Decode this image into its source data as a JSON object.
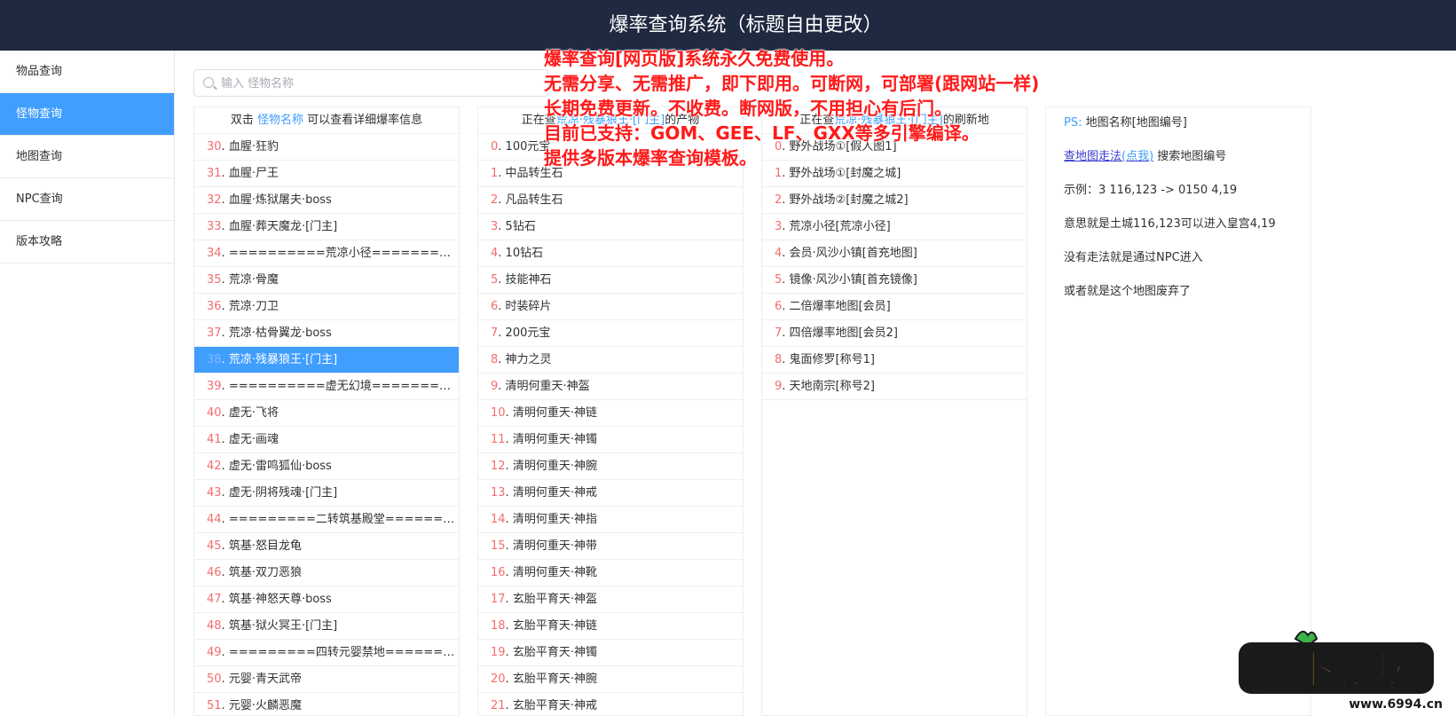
{
  "app": {
    "title": "爆率查询系统（标题自由更改）"
  },
  "sidebar": {
    "items": [
      {
        "label": "物品查询",
        "active": false
      },
      {
        "label": "怪物查询",
        "active": true
      },
      {
        "label": "地图查询",
        "active": false
      },
      {
        "label": "NPC查询",
        "active": false
      },
      {
        "label": "版本攻略",
        "active": false
      }
    ]
  },
  "search": {
    "placeholder": "输入 怪物名称",
    "value": ""
  },
  "monsters": {
    "header": {
      "prefix": "双击 ",
      "highlight": "怪物名称",
      "suffix": " 可以查看详细爆率信息"
    },
    "rows": [
      {
        "num": "30",
        "name": "血腥·狂豹"
      },
      {
        "num": "31",
        "name": "血腥·尸王"
      },
      {
        "num": "32",
        "name": "血腥·炼狱屠夫·boss"
      },
      {
        "num": "33",
        "name": "血腥·葬天魔龙·[门主]"
      },
      {
        "num": "34",
        "name": "==========荒凉小径=========="
      },
      {
        "num": "35",
        "name": "荒凉·骨魔"
      },
      {
        "num": "36",
        "name": "荒凉·刀卫"
      },
      {
        "num": "37",
        "name": "荒凉·枯骨翼龙·boss"
      },
      {
        "num": "38",
        "name": "荒凉·残暴狼王·[门主]",
        "selected": true
      },
      {
        "num": "39",
        "name": "==========虚无幻境=========="
      },
      {
        "num": "40",
        "name": "虚无·飞将"
      },
      {
        "num": "41",
        "name": "虚无·画魂"
      },
      {
        "num": "42",
        "name": "虚无·雷鸣狐仙·boss"
      },
      {
        "num": "43",
        "name": "虚无·阴将残魂·[门主]"
      },
      {
        "num": "44",
        "name": "=========二转筑基殿堂=========="
      },
      {
        "num": "45",
        "name": "筑基·怒目龙龟"
      },
      {
        "num": "46",
        "name": "筑基·双刀恶狼"
      },
      {
        "num": "47",
        "name": "筑基·神怒天尊·boss"
      },
      {
        "num": "48",
        "name": "筑基·狱火冥王·[门主]"
      },
      {
        "num": "49",
        "name": "=========四转元婴禁地=========="
      },
      {
        "num": "50",
        "name": "元婴·青天武帝"
      },
      {
        "num": "51",
        "name": "元婴·火麟恶魔"
      }
    ]
  },
  "drops": {
    "header": {
      "prefix": "正在查",
      "highlight": "荒凉·残暴狼王·[门主]",
      "suffix": "的产物"
    },
    "rows": [
      {
        "num": "0",
        "name": "100元宝"
      },
      {
        "num": "1",
        "name": "中品转生石"
      },
      {
        "num": "2",
        "name": "凡品转生石"
      },
      {
        "num": "3",
        "name": "5钻石"
      },
      {
        "num": "4",
        "name": "10钻石"
      },
      {
        "num": "5",
        "name": "技能神石"
      },
      {
        "num": "6",
        "name": "时装碎片"
      },
      {
        "num": "7",
        "name": "200元宝"
      },
      {
        "num": "8",
        "name": "神力之灵"
      },
      {
        "num": "9",
        "name": "清明何重天·神盔"
      },
      {
        "num": "10",
        "name": "清明何重天·神链"
      },
      {
        "num": "11",
        "name": "清明何重天·神镯"
      },
      {
        "num": "12",
        "name": "清明何重天·神腕"
      },
      {
        "num": "13",
        "name": "清明何重天·神戒"
      },
      {
        "num": "14",
        "name": "清明何重天·神指"
      },
      {
        "num": "15",
        "name": "清明何重天·神带"
      },
      {
        "num": "16",
        "name": "清明何重天·神靴"
      },
      {
        "num": "17",
        "name": "玄胎平育天·神盔"
      },
      {
        "num": "18",
        "name": "玄胎平育天·神链"
      },
      {
        "num": "19",
        "name": "玄胎平育天·神镯"
      },
      {
        "num": "20",
        "name": "玄胎平育天·神腕"
      },
      {
        "num": "21",
        "name": "玄胎平育天·神戒"
      }
    ]
  },
  "maps": {
    "header": {
      "prefix": "正在查",
      "highlight": "荒凉·残暴狼王·[门主]",
      "suffix": "的刷新地"
    },
    "rows": [
      {
        "num": "0",
        "name": "野外战场①[假人图1]"
      },
      {
        "num": "1",
        "name": "野外战场①[封魔之城]"
      },
      {
        "num": "2",
        "name": "野外战场②[封魔之城2]"
      },
      {
        "num": "3",
        "name": "荒凉小径[荒凉小径]"
      },
      {
        "num": "4",
        "name": "会员·风沙小镇[首充地图]"
      },
      {
        "num": "5",
        "name": "镜像·风沙小镇[首充镜像]"
      },
      {
        "num": "6",
        "name": "二倍爆率地图[会员]"
      },
      {
        "num": "7",
        "name": "四倍爆率地图[会员2]"
      },
      {
        "num": "8",
        "name": "鬼面修罗[称号1]"
      },
      {
        "num": "9",
        "name": "天地南宗[称号2]"
      }
    ]
  },
  "info": {
    "ps_label": "PS:",
    "ps_text": " 地图名称[地图编号]",
    "link_text": "查地图走法",
    "link_hint": "(点我)",
    "link_suffix": " 搜索地图编号",
    "example": "示例：3 116,123 -> 0150 4,19",
    "meaning": "意思就是土城116,123可以进入皇宫4,19",
    "no_path": "没有走法就是通过NPC进入",
    "abandoned": "或者就是这个地图废弃了"
  },
  "overlay": {
    "lines": [
      "爆率查询[网页版]系统永久免费使用。",
      "无需分享、无需推广，即下即用。可断网，可部署(跟网站一样)",
      "长期免费更新。不收费。断网版，不用担心有后门。",
      "目前已支持：GOM、GEE、LF、GXX等多引擎编译。",
      "提供多版本爆率查询模板。"
    ]
  },
  "watermark": {
    "logo_text": "萝卜论坛",
    "site": "www.6994.cn"
  }
}
